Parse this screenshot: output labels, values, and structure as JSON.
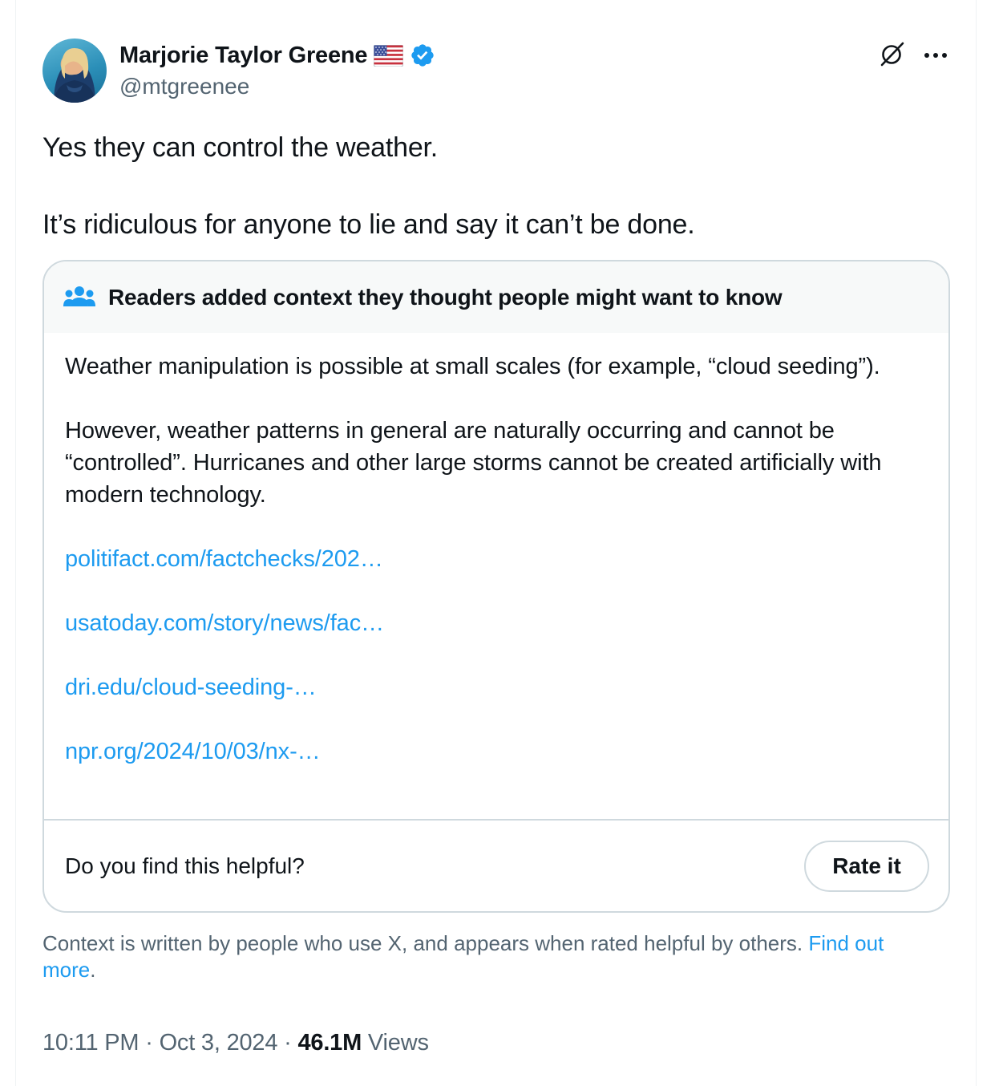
{
  "author": {
    "display_name": "Marjorie Taylor Greene",
    "handle": "@mtgreenee",
    "flag_icon": "us-flag-icon",
    "verified_icon": "verified-badge-icon",
    "verified_color": "#1d9bf0"
  },
  "header_actions": {
    "grok_icon": "grok-icon",
    "more_icon": "more-options-icon"
  },
  "tweet": {
    "line1": "Yes they can control the weather.",
    "line2": "It’s ridiculous for anyone to lie and say it can’t be done."
  },
  "community_note": {
    "icon": "people-icon",
    "title": "Readers added context they thought people might want to know",
    "paragraph1": "Weather manipulation is possible at small scales (for example, “cloud seeding”).",
    "paragraph2": "However, weather patterns in general are naturally occurring and cannot be “controlled”. Hurricanes and other large storms cannot be created artificially with modern technology.",
    "links": [
      "politifact.com/factchecks/202…",
      "usatoday.com/story/news/fac…",
      "dri.edu/cloud-seeding-…",
      "npr.org/2024/10/03/nx-…"
    ],
    "helpful_question": "Do you find this helpful?",
    "rate_button": "Rate it"
  },
  "context_notice": {
    "text": "Context is written by people who use X, and appears when rated helpful by others. ",
    "link": "Find out more",
    "trailing": "."
  },
  "meta": {
    "time": "10:11 PM",
    "separator": " · ",
    "date": "Oct 3, 2024",
    "views_count": "46.1M",
    "views_label": " Views"
  },
  "colors": {
    "link": "#1d9bf0",
    "secondary_text": "#536471",
    "border": "#cfd9de"
  }
}
